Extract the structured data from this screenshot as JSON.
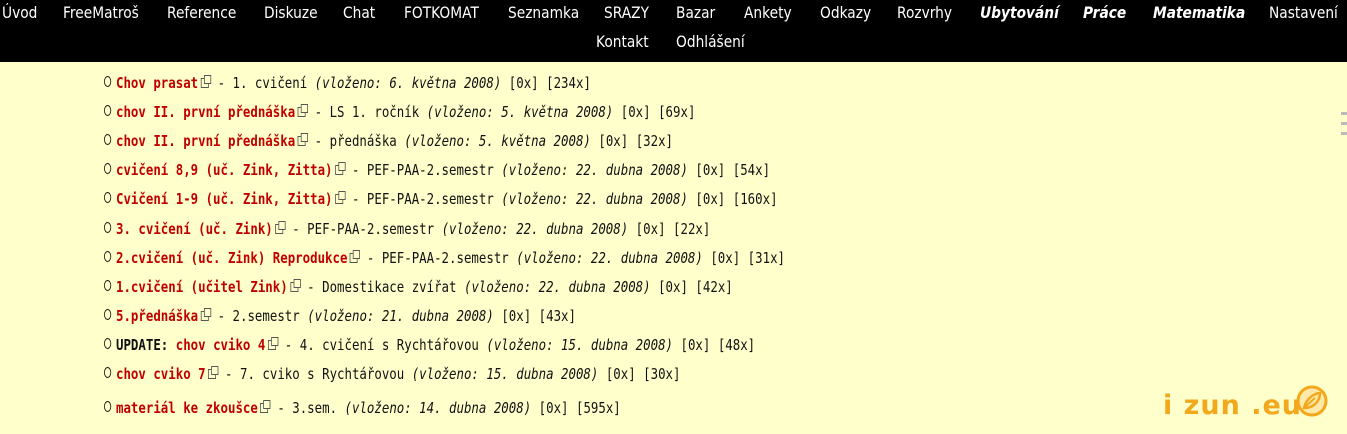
{
  "nav": {
    "row1": [
      "Úvod",
      "FreeMatroš",
      "Reference",
      "Diskuze",
      "Chat",
      "FOTKOMAT",
      "Seznamka",
      "SRAZY",
      "Bazar",
      "Ankety",
      "Odkazy",
      "Rozvrhy",
      "Ubytování",
      "Práce",
      "Matematika",
      "Nastavení"
    ],
    "row2": [
      "Kontakt",
      "Odhlášení"
    ]
  },
  "files": [
    {
      "link": "Chov prasat",
      "desc": "1. cvičení",
      "date": "(vloženo: 6. května 2008)",
      "a": "[0x]",
      "b": "[234x]"
    },
    {
      "link": "chov II. první přednáška",
      "desc": "LS 1. ročník",
      "date": "(vloženo: 5. května 2008)",
      "a": "[0x]",
      "b": "[69x]"
    },
    {
      "link": "chov II. první přednáška",
      "desc": "přednáška",
      "date": "(vloženo: 5. května 2008)",
      "a": "[0x]",
      "b": "[32x]"
    },
    {
      "link": "cvičení 8,9 (uč. Zink, Zitta)",
      "desc": "PEF-PAA-2.semestr",
      "date": "(vloženo: 22. dubna 2008)",
      "a": "[0x]",
      "b": "[54x]"
    },
    {
      "link": "Cvičení 1-9 (uč. Zink, Zitta)",
      "desc": "PEF-PAA-2.semestr",
      "date": "(vloženo: 22. dubna 2008)",
      "a": "[0x]",
      "b": "[160x]"
    },
    {
      "link": "3. cvičení (uč. Zink)",
      "desc": "PEF-PAA-2.semestr",
      "date": "(vloženo: 22. dubna 2008)",
      "a": "[0x]",
      "b": "[22x]"
    },
    {
      "link": "2.cvičení (uč. Zink) Reprodukce",
      "desc": "PEF-PAA-2.semestr",
      "date": "(vloženo: 22. dubna 2008)",
      "a": "[0x]",
      "b": "[31x]"
    },
    {
      "link": "1.cvičení (učitel Zink)",
      "desc": "Domestikace zvířat",
      "date": "(vloženo: 22. dubna 2008)",
      "a": "[0x]",
      "b": "[42x]"
    },
    {
      "link": "5.přednáška",
      "desc": "2.semestr",
      "date": "(vloženo: 21. dubna 2008)",
      "a": "[0x]",
      "b": "[43x]"
    },
    {
      "prefix": "UPDATE:",
      "link": "chov cviko 4",
      "desc": "4. cvičení s Rychtářovou",
      "date": "(vloženo: 15. dubna 2008)",
      "a": "[0x]",
      "b": "[48x]"
    },
    {
      "link": "chov cviko 7",
      "desc": "7. cviko s Rychtářovou",
      "date": "(vloženo: 15. dubna 2008)",
      "a": "[0x]",
      "b": "[30x]"
    },
    {
      "link": "materiál ke zkoušce",
      "desc": "3.sem.",
      "date": "(vloženo: 14. dubna 2008)",
      "a": "[0x]",
      "b": "[595x]"
    }
  ],
  "logo": {
    "text": "i zun .eu"
  },
  "colors": {
    "link": "#c00000",
    "background": "#ffffcc",
    "nav_bg": "#000000",
    "logo": "#f2a81d"
  },
  "icons": {
    "external": "external-link-icon",
    "bullet": "circle-bullet-icon"
  }
}
